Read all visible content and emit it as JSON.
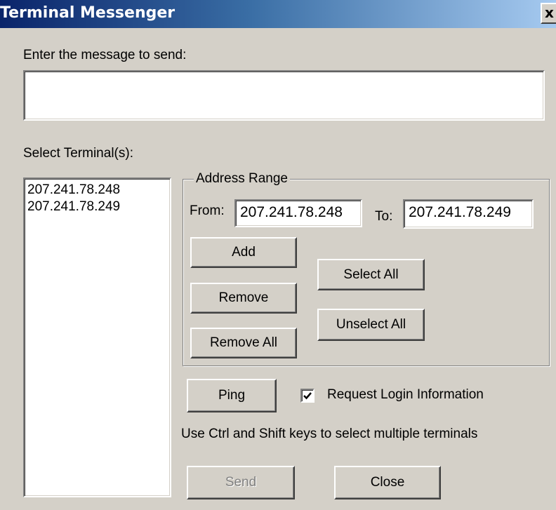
{
  "window": {
    "title": "Terminal Messenger",
    "close_glyph": "x"
  },
  "message": {
    "label": "Enter the message to send:",
    "value": ""
  },
  "terminals": {
    "label": "Select Terminal(s):",
    "items": [
      "207.241.78.248",
      "207.241.78.249"
    ]
  },
  "address_range": {
    "legend": "Address Range",
    "from_label": "From:",
    "from_value": "207.241.78.248",
    "to_label": "To:",
    "to_value": "207.241.78.249"
  },
  "buttons": {
    "add": "Add",
    "remove": "Remove",
    "remove_all": "Remove All",
    "select_all": "Select All",
    "unselect_all": "Unselect All",
    "ping": "Ping",
    "send": "Send",
    "close": "Close"
  },
  "login_checkbox": {
    "label": "Request Login Information",
    "checked": true
  },
  "hint": "Use Ctrl and Shift keys to select multiple terminals",
  "colors": {
    "face": "#d4d0c8",
    "title_start": "#0a246a",
    "title_end": "#a6caf0",
    "disabled_text": "#808080"
  }
}
